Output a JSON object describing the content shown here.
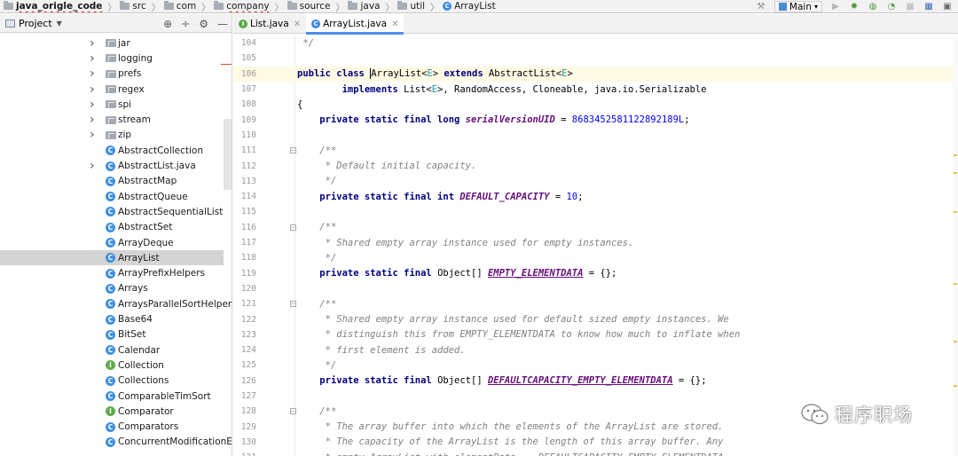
{
  "breadcrumb": {
    "project": "java_origle_code",
    "items": [
      "src",
      "com",
      "company",
      "source",
      "java",
      "util"
    ],
    "file": "ArrayList"
  },
  "run_config": {
    "label": "Main"
  },
  "project_panel": {
    "title": "Project",
    "tree": [
      {
        "label": "jar",
        "type": "folder",
        "expand": true
      },
      {
        "label": "logging",
        "type": "folder",
        "expand": true
      },
      {
        "label": "prefs",
        "type": "folder",
        "expand": true
      },
      {
        "label": "regex",
        "type": "folder",
        "expand": true
      },
      {
        "label": "spi",
        "type": "folder",
        "expand": true
      },
      {
        "label": "stream",
        "type": "folder",
        "expand": true
      },
      {
        "label": "zip",
        "type": "folder",
        "expand": true
      },
      {
        "label": "AbstractCollection",
        "type": "class",
        "expand": false
      },
      {
        "label": "AbstractList.java",
        "type": "class",
        "expand": true
      },
      {
        "label": "AbstractMap",
        "type": "class",
        "expand": false
      },
      {
        "label": "AbstractQueue",
        "type": "class",
        "expand": false
      },
      {
        "label": "AbstractSequentialList",
        "type": "class",
        "expand": false
      },
      {
        "label": "AbstractSet",
        "type": "class",
        "expand": false
      },
      {
        "label": "ArrayDeque",
        "type": "class",
        "expand": false
      },
      {
        "label": "ArrayList",
        "type": "class",
        "expand": false,
        "selected": true
      },
      {
        "label": "ArrayPrefixHelpers",
        "type": "class",
        "expand": false
      },
      {
        "label": "Arrays",
        "type": "class",
        "expand": false
      },
      {
        "label": "ArraysParallelSortHelpers",
        "type": "class",
        "expand": false
      },
      {
        "label": "Base64",
        "type": "class",
        "expand": false
      },
      {
        "label": "BitSet",
        "type": "class",
        "expand": false
      },
      {
        "label": "Calendar",
        "type": "class",
        "expand": false
      },
      {
        "label": "Collection",
        "type": "interface",
        "expand": false
      },
      {
        "label": "Collections",
        "type": "class",
        "expand": false
      },
      {
        "label": "ComparableTimSort",
        "type": "class",
        "expand": false
      },
      {
        "label": "Comparator",
        "type": "interface",
        "expand": false
      },
      {
        "label": "Comparators",
        "type": "class",
        "expand": false
      },
      {
        "label": "ConcurrentModificationExc",
        "type": "class",
        "expand": false
      }
    ]
  },
  "tabs": [
    {
      "label": "List.java",
      "active": false
    },
    {
      "label": "ArrayList.java",
      "active": true
    }
  ],
  "editor": {
    "lines": [
      {
        "n": "104",
        "html": "<span class=\"cmt\"> */</span>"
      },
      {
        "n": "105",
        "html": ""
      },
      {
        "n": "106",
        "caret": true,
        "html": "<span class=\"kw\">public class </span><span class=\"caretmark\">A</span>rrayList&lt;<span class=\"tp\">E</span>&gt; <span class=\"kw\">extends </span>AbstractList&lt;<span class=\"tp\">E</span>&gt;"
      },
      {
        "n": "107",
        "html": "        <span class=\"kw\">implements </span>List&lt;<span class=\"tp\">E</span>&gt;, RandomAccess, Cloneable, java.io.Serializable"
      },
      {
        "n": "108",
        "html": "{"
      },
      {
        "n": "109",
        "html": "    <span class=\"kw\">private static final long </span><span class=\"cst\">serialVersionUID</span> = <span class=\"num\">8683452581122892189L</span>;"
      },
      {
        "n": "110",
        "html": ""
      },
      {
        "n": "111",
        "fold": true,
        "html": "    <span class=\"cmt\">/**</span>"
      },
      {
        "n": "112",
        "html": "<span class=\"cmt\">     * Default initial capacity.</span>"
      },
      {
        "n": "113",
        "html": "<span class=\"cmt\">     */</span>"
      },
      {
        "n": "114",
        "html": "    <span class=\"kw\">private static final int </span><span class=\"cst\">DEFAULT_CAPACITY</span> = <span class=\"num\">10</span>;"
      },
      {
        "n": "115",
        "html": ""
      },
      {
        "n": "116",
        "fold": true,
        "html": "    <span class=\"cmt\">/**</span>"
      },
      {
        "n": "117",
        "html": "<span class=\"cmt\">     * Shared empty array instance used for empty instances.</span>"
      },
      {
        "n": "118",
        "html": "<span class=\"cmt\">     */</span>"
      },
      {
        "n": "119",
        "html": "    <span class=\"kw\">private static final </span>Object[] <span class=\"cstu\">EMPTY_ELEMENTDATA</span> = {};"
      },
      {
        "n": "120",
        "html": ""
      },
      {
        "n": "121",
        "fold": true,
        "html": "    <span class=\"cmt\">/**</span>"
      },
      {
        "n": "122",
        "html": "<span class=\"cmt\">     * Shared empty array instance used for default sized empty instances. We</span>"
      },
      {
        "n": "123",
        "html": "<span class=\"cmt\">     * distinguish this from EMPTY_ELEMENTDATA to know how much to inflate when</span>"
      },
      {
        "n": "124",
        "html": "<span class=\"cmt\">     * first element is added.</span>"
      },
      {
        "n": "125",
        "html": "<span class=\"cmt\">     */</span>"
      },
      {
        "n": "126",
        "html": "    <span class=\"kw\">private static final </span>Object[] <span class=\"cstu\">DEFAULTCAPACITY_EMPTY_ELEMENTDATA</span> = {};"
      },
      {
        "n": "127",
        "html": ""
      },
      {
        "n": "128",
        "fold": true,
        "html": "    <span class=\"cmt\">/**</span>"
      },
      {
        "n": "129",
        "html": "<span class=\"cmt\">     * The array buffer into which the elements of the ArrayList are stored.</span>"
      },
      {
        "n": "130",
        "html": "<span class=\"cmt\">     * The capacity of the ArrayList is the length of this array buffer. Any</span>"
      },
      {
        "n": "131",
        "html": "<span class=\"cmt\">     * empty ArrayList with elementData == DEFAULTCAPACITY_EMPTY_ELEMENTDATA</span>"
      }
    ]
  },
  "watermark": {
    "text": "程序职场"
  }
}
